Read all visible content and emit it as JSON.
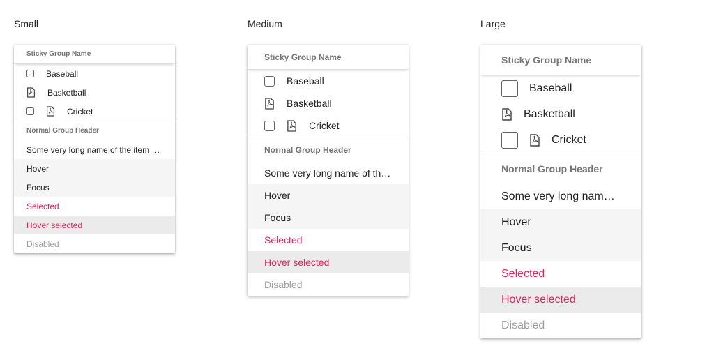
{
  "small": {
    "title": "Small",
    "sticky_header": "Sticky Group Name",
    "items_group1": [
      "Baseball",
      "Basketball",
      "Cricket"
    ],
    "normal_header": "Normal Group Header",
    "long_item": "Some very long name of the item g...",
    "hover": "Hover",
    "focus": "Focus",
    "selected": "Selected",
    "hover_selected": "Hover selected",
    "disabled": "Disabled"
  },
  "medium": {
    "title": "Medium",
    "sticky_header": "Sticky Group Name",
    "items_group1": [
      "Baseball",
      "Basketball",
      "Cricket"
    ],
    "normal_header": "Normal Group Header",
    "long_item": "Some very long name of the...",
    "hover": "Hover",
    "focus": "Focus",
    "selected": "Selected",
    "hover_selected": "Hover selected",
    "disabled": "Disabled"
  },
  "large": {
    "title": "Large",
    "sticky_header": "Sticky Group Name",
    "items_group1": [
      "Baseball",
      "Basketball",
      "Cricket"
    ],
    "normal_header": "Normal Group Header",
    "long_item": "Some very long name ...",
    "hover": "Hover",
    "focus": "Focus",
    "selected": "Selected",
    "hover_selected": "Hover selected",
    "disabled": "Disabled"
  },
  "colors": {
    "selected_text": "#e0245e",
    "hover_bg": "#f5f5f5",
    "hover_selected_bg": "#ebebeb",
    "disabled_text": "#9e9e9e",
    "header_text": "#757575"
  },
  "icons": [
    "checkbox-icon",
    "pdf-file-icon"
  ]
}
